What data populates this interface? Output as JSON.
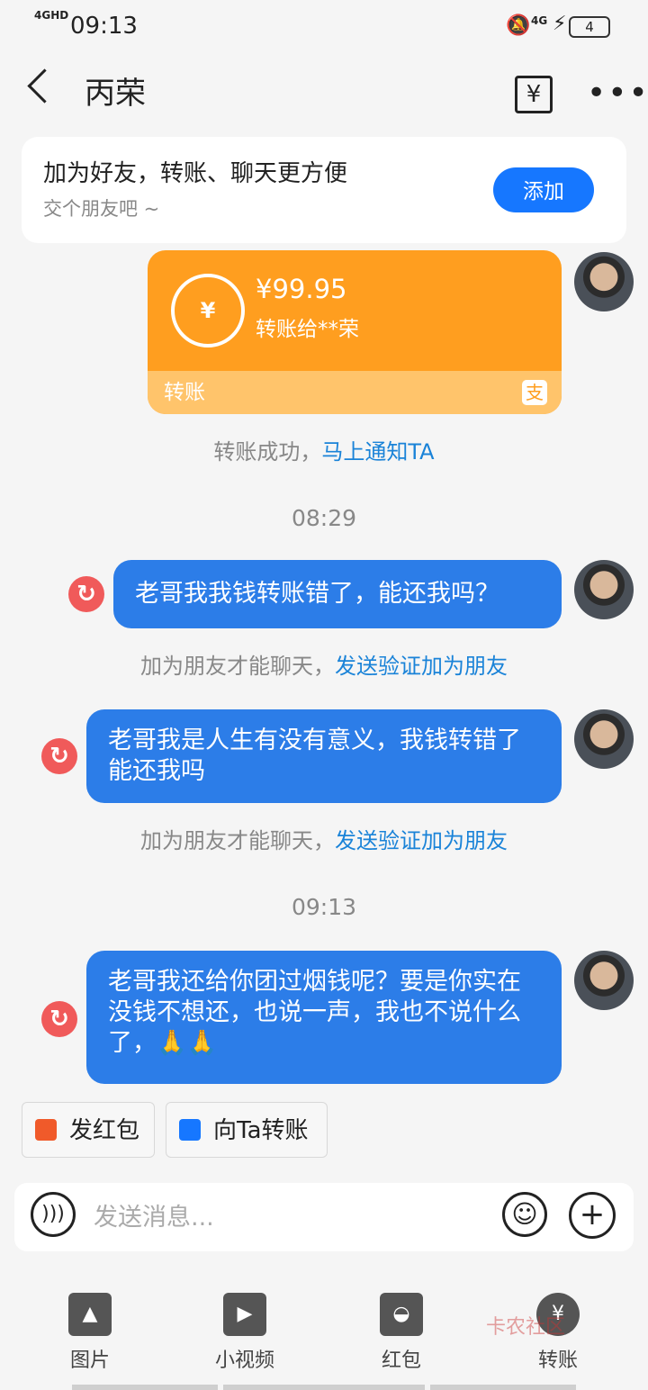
{
  "status": {
    "network": "4GHD",
    "time": "09:13",
    "signal": "4G",
    "battery": "4"
  },
  "header": {
    "title": "丙荣"
  },
  "add_friend": {
    "title": "加为好友，转账、聊天更方便",
    "subtitle": "交个朋友吧 ~",
    "button": "添加"
  },
  "transfer": {
    "amount": "¥99.95",
    "to": "转账给**荣",
    "label": "转账",
    "currency_symbol": "¥",
    "app_badge": "支"
  },
  "notice_transfer": {
    "text": "转账成功，",
    "link": "马上通知TA"
  },
  "times": [
    "08:29",
    "09:13"
  ],
  "messages": [
    {
      "text": "老哥我我钱转账错了，能还我吗？"
    },
    {
      "text": "老哥我是人生有没有意义，我钱转错了能还我吗"
    },
    {
      "text": "老哥我还给你团过烟钱呢？要是你实在没钱不想还，也说一声，我也不说什么了，🙏🙏"
    }
  ],
  "notice_friend": {
    "text": "加为朋友才能聊天，",
    "link": "发送验证加为朋友"
  },
  "chips": {
    "red_packet": "发红包",
    "transfer": "向Ta转账"
  },
  "input": {
    "placeholder": "发送消息..."
  },
  "tools": {
    "image": "图片",
    "video": "小视频",
    "red_packet": "红包",
    "transfer": "转账"
  },
  "watermark": "卡农社区",
  "colors": {
    "accent": "#1677ff",
    "bubble": "#2c7de8",
    "transfer_card": "#ff9e1f",
    "retry": "#f05a5a"
  }
}
